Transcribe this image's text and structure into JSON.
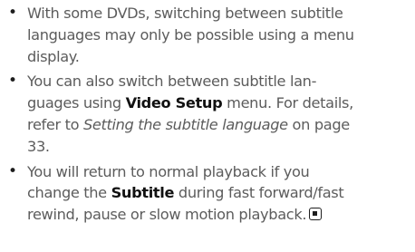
{
  "notes": [
    {
      "lines": [
        "With some DVDs, switching between subtitle",
        "languages may only be possible using a menu",
        "display."
      ]
    },
    {
      "line1": "You can also switch between subtitle lan-",
      "line2_text": "guages using ",
      "line2_bold": "Video Setup",
      "line2_rest": " menu. For details,",
      "line3_text": "refer to ",
      "line3_italic": "Setting the subtitle language",
      "line3_rest": " on page",
      "line4": "33."
    },
    {
      "line1": "You will return to normal playback if you",
      "line2_text": "change the ",
      "line2_bold": "Subtitle",
      "line2_rest": " during fast forward/fast",
      "line3": "rewind, pause or slow motion playback.",
      "end_mark_icon": "end-of-section-icon"
    }
  ]
}
